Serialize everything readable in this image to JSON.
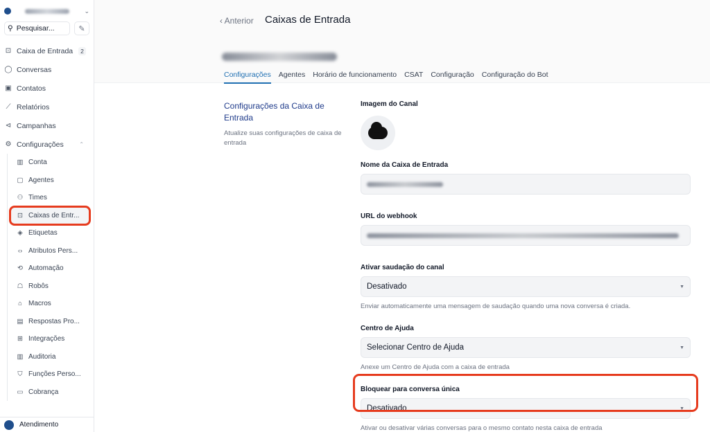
{
  "sidebar": {
    "search_placeholder": "Pesquisar...",
    "nav": [
      {
        "label": "Caixa de Entrada",
        "icon": "inbox-icon",
        "badge": "2"
      },
      {
        "label": "Conversas",
        "icon": "chat-bubble-icon"
      },
      {
        "label": "Contatos",
        "icon": "contact-card-icon"
      },
      {
        "label": "Relatórios",
        "icon": "chart-icon"
      },
      {
        "label": "Campanhas",
        "icon": "megaphone-icon"
      },
      {
        "label": "Configurações",
        "icon": "gear-icon"
      }
    ],
    "settings_items": [
      {
        "label": "Conta",
        "icon": "building-icon"
      },
      {
        "label": "Agentes",
        "icon": "user-square-icon"
      },
      {
        "label": "Times",
        "icon": "users-icon"
      },
      {
        "label": "Caixas de Entr...",
        "icon": "inbox-icon"
      },
      {
        "label": "Etiquetas",
        "icon": "tag-icon"
      },
      {
        "label": "Atributos Pers...",
        "icon": "code-icon"
      },
      {
        "label": "Automação",
        "icon": "automation-icon"
      },
      {
        "label": "Robôs",
        "icon": "robot-icon"
      },
      {
        "label": "Macros",
        "icon": "macro-icon"
      },
      {
        "label": "Respostas Pro...",
        "icon": "canned-response-icon"
      },
      {
        "label": "Integrações",
        "icon": "puzzle-icon"
      },
      {
        "label": "Auditoria",
        "icon": "audit-icon"
      },
      {
        "label": "Funções Perso...",
        "icon": "shield-icon"
      },
      {
        "label": "Cobrança",
        "icon": "credit-card-icon"
      }
    ],
    "footer_label": "Atendimento"
  },
  "header": {
    "back_label": "Anterior",
    "title": "Caixas de Entrada",
    "tabs": [
      "Configurações",
      "Agentes",
      "Horário de funcionamento",
      "CSAT",
      "Configuração",
      "Configuração do Bot"
    ]
  },
  "left": {
    "title": "Configurações da Caixa de Entrada",
    "description": "Atualize suas configurações de caixa de entrada"
  },
  "form": {
    "channel_image_label": "Imagem do Canal",
    "inbox_name_label": "Nome da Caixa de Entrada",
    "webhook_label": "URL do webhook",
    "greeting_label": "Ativar saudação do canal",
    "greeting_value": "Desativado",
    "greeting_hint": "Enviar automaticamente uma mensagem de saudação quando uma nova conversa é criada.",
    "help_center_label": "Centro de Ajuda",
    "help_center_value": "Selecionar Centro de Ajuda",
    "help_center_hint": "Anexe um Centro de Ajuda com a caixa de entrada",
    "lock_label": "Bloquear para conversa única",
    "lock_value": "Desativado",
    "lock_hint": "Ativar ou desativar várias conversas para o mesmo contato nesta caixa de entrada"
  },
  "colors": {
    "accent": "#1f6fb2",
    "highlight": "#e63b1e"
  }
}
